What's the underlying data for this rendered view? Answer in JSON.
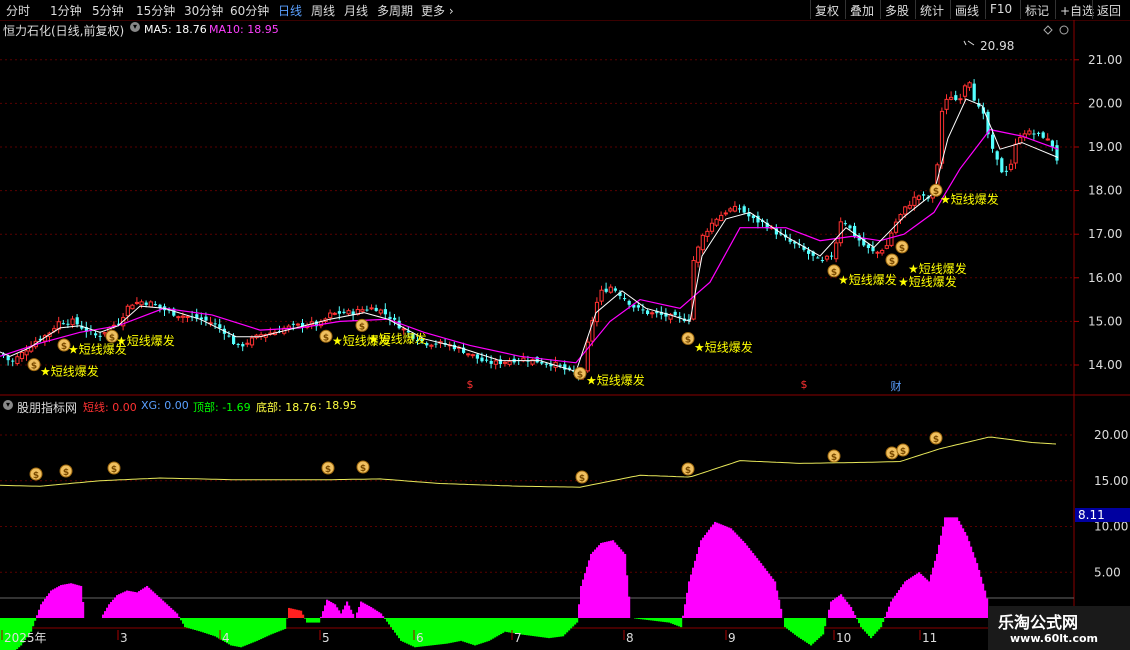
{
  "toolbar": {
    "periods": [
      "分时",
      "1分钟",
      "5分钟",
      "15分钟",
      "30分钟",
      "60分钟",
      "日线",
      "周线",
      "月线",
      "多周期",
      "更多"
    ],
    "selected": "日线",
    "right_buttons": [
      "复权",
      "叠加",
      "多股",
      "统计",
      "画线",
      "F10",
      "标记",
      "+自选",
      "返回"
    ]
  },
  "main_header": {
    "stock_label": "恒力石化(日线,前复权)",
    "ma5": "MA5: 18.76",
    "ma10": "MA10: 18.95"
  },
  "indicator_header": {
    "name": "股朋指标网",
    "duanxian": "短线: 0.00",
    "xg": "XG: 0.00",
    "dingbu": "顶部: -1.69",
    "dibu": "底部: 18.76",
    "dibu2": ": 18.95"
  },
  "price_axis_labels": [
    "21.00",
    "20.00",
    "19.00",
    "18.00",
    "17.00",
    "16.00",
    "15.00",
    "14.00"
  ],
  "indicator_axis_labels": [
    "20.00",
    "15.00",
    "10.00",
    "5.00"
  ],
  "indicator_current_value": "8.11",
  "max_price_label": "20.98",
  "signal_label": "★短线爆发",
  "event_markers": {
    "s": "$",
    "cai": "财"
  },
  "date_labels": [
    "2025年",
    "3",
    "4",
    "5",
    "6",
    "7",
    "8",
    "9",
    "10",
    "11"
  ],
  "brand": {
    "name": "乐淘公式网",
    "url": "www.60lt.com"
  },
  "colors": {
    "up": "#ff3232",
    "down": "#54ffff",
    "ma5": "#ffffff",
    "ma10": "#ff00ff",
    "signal": "#ffff00",
    "magenta_bar": "#ff00ff",
    "green_bar": "#00ff00"
  },
  "chart_data": {
    "type": "candlestick",
    "ylim": [
      13.5,
      21.3
    ],
    "keypoints": [
      [
        0,
        14.25
      ],
      [
        10,
        14.05
      ],
      [
        22,
        14.3
      ],
      [
        34,
        14.55
      ],
      [
        46,
        14.7
      ],
      [
        58,
        15.0
      ],
      [
        72,
        15.0
      ],
      [
        84,
        14.8
      ],
      [
        96,
        14.65
      ],
      [
        108,
        14.85
      ],
      [
        118,
        15.0
      ],
      [
        128,
        15.4
      ],
      [
        140,
        15.45
      ],
      [
        152,
        15.4
      ],
      [
        164,
        15.25
      ],
      [
        176,
        15.15
      ],
      [
        188,
        15.1
      ],
      [
        200,
        15.05
      ],
      [
        212,
        14.95
      ],
      [
        224,
        14.75
      ],
      [
        236,
        14.4
      ],
      [
        248,
        14.55
      ],
      [
        260,
        14.7
      ],
      [
        272,
        14.75
      ],
      [
        284,
        14.85
      ],
      [
        296,
        14.9
      ],
      [
        308,
        14.95
      ],
      [
        318,
        14.9
      ],
      [
        328,
        15.15
      ],
      [
        340,
        15.2
      ],
      [
        352,
        15.2
      ],
      [
        364,
        15.3
      ],
      [
        376,
        15.3
      ],
      [
        388,
        15.1
      ],
      [
        400,
        14.85
      ],
      [
        412,
        14.65
      ],
      [
        424,
        14.5
      ],
      [
        436,
        14.5
      ],
      [
        448,
        14.45
      ],
      [
        460,
        14.35
      ],
      [
        472,
        14.2
      ],
      [
        484,
        14.05
      ],
      [
        496,
        14.05
      ],
      [
        508,
        14.1
      ],
      [
        520,
        14.15
      ],
      [
        532,
        14.1
      ],
      [
        544,
        14.05
      ],
      [
        556,
        14.0
      ],
      [
        566,
        13.85
      ],
      [
        576,
        13.8
      ],
      [
        582,
        13.75
      ],
      [
        588,
        14.8
      ],
      [
        598,
        15.65
      ],
      [
        610,
        15.8
      ],
      [
        622,
        15.55
      ],
      [
        634,
        15.3
      ],
      [
        646,
        15.2
      ],
      [
        658,
        15.15
      ],
      [
        670,
        15.1
      ],
      [
        682,
        15.05
      ],
      [
        688,
        15.1
      ],
      [
        692,
        16.4
      ],
      [
        702,
        17.0
      ],
      [
        714,
        17.35
      ],
      [
        726,
        17.55
      ],
      [
        738,
        17.6
      ],
      [
        750,
        17.35
      ],
      [
        762,
        17.25
      ],
      [
        774,
        17.05
      ],
      [
        786,
        16.85
      ],
      [
        798,
        16.7
      ],
      [
        810,
        16.5
      ],
      [
        820,
        16.35
      ],
      [
        832,
        16.55
      ],
      [
        840,
        17.4
      ],
      [
        852,
        17.0
      ],
      [
        864,
        16.7
      ],
      [
        874,
        16.55
      ],
      [
        886,
        16.75
      ],
      [
        892,
        17.2
      ],
      [
        904,
        17.6
      ],
      [
        916,
        17.9
      ],
      [
        926,
        17.8
      ],
      [
        934,
        18.1
      ],
      [
        940,
        19.8
      ],
      [
        948,
        20.2
      ],
      [
        956,
        20.05
      ],
      [
        962,
        20.3
      ],
      [
        966,
        20.7
      ],
      [
        974,
        20.0
      ],
      [
        982,
        19.7
      ],
      [
        990,
        18.95
      ],
      [
        1000,
        18.45
      ],
      [
        1008,
        18.5
      ],
      [
        1016,
        19.2
      ],
      [
        1022,
        19.35
      ],
      [
        1032,
        19.3
      ],
      [
        1042,
        19.25
      ],
      [
        1052,
        19.0
      ],
      [
        1058,
        18.5
      ]
    ],
    "ma5_path": [
      [
        0,
        14.3
      ],
      [
        10,
        14.2
      ],
      [
        30,
        14.4
      ],
      [
        46,
        14.65
      ],
      [
        60,
        14.85
      ],
      [
        80,
        14.9
      ],
      [
        100,
        14.75
      ],
      [
        118,
        14.9
      ],
      [
        140,
        15.35
      ],
      [
        164,
        15.3
      ],
      [
        200,
        15.05
      ],
      [
        236,
        14.65
      ],
      [
        260,
        14.65
      ],
      [
        296,
        14.85
      ],
      [
        330,
        15.05
      ],
      [
        364,
        15.2
      ],
      [
        388,
        15.05
      ],
      [
        424,
        14.6
      ],
      [
        460,
        14.4
      ],
      [
        500,
        14.1
      ],
      [
        540,
        14.1
      ],
      [
        576,
        13.85
      ],
      [
        596,
        15.2
      ],
      [
        622,
        15.7
      ],
      [
        646,
        15.3
      ],
      [
        670,
        15.15
      ],
      [
        690,
        15.0
      ],
      [
        702,
        16.5
      ],
      [
        726,
        17.35
      ],
      [
        750,
        17.5
      ],
      [
        786,
        16.95
      ],
      [
        820,
        16.5
      ],
      [
        846,
        17.15
      ],
      [
        874,
        16.7
      ],
      [
        904,
        17.4
      ],
      [
        934,
        17.95
      ],
      [
        948,
        19.2
      ],
      [
        966,
        20.1
      ],
      [
        982,
        19.95
      ],
      [
        1000,
        18.95
      ],
      [
        1022,
        19.1
      ],
      [
        1058,
        18.76
      ]
    ],
    "ma10_path": [
      [
        0,
        14.2
      ],
      [
        40,
        14.5
      ],
      [
        80,
        14.75
      ],
      [
        118,
        14.9
      ],
      [
        164,
        15.3
      ],
      [
        212,
        15.15
      ],
      [
        260,
        14.8
      ],
      [
        300,
        14.85
      ],
      [
        340,
        15.0
      ],
      [
        388,
        15.05
      ],
      [
        424,
        14.75
      ],
      [
        470,
        14.45
      ],
      [
        520,
        14.2
      ],
      [
        576,
        14.05
      ],
      [
        610,
        15.0
      ],
      [
        640,
        15.5
      ],
      [
        680,
        15.3
      ],
      [
        710,
        15.9
      ],
      [
        740,
        17.15
      ],
      [
        786,
        17.15
      ],
      [
        820,
        16.85
      ],
      [
        852,
        16.95
      ],
      [
        880,
        16.85
      ],
      [
        904,
        17.0
      ],
      [
        934,
        17.5
      ],
      [
        960,
        18.5
      ],
      [
        990,
        19.4
      ],
      [
        1022,
        19.25
      ],
      [
        1058,
        18.95
      ]
    ],
    "signals": [
      [
        34,
        14.1
      ],
      [
        64,
        14.55
      ],
      [
        112,
        14.75
      ],
      [
        326,
        14.75
      ],
      [
        362,
        15.0
      ],
      [
        580,
        13.9
      ],
      [
        688,
        14.7
      ],
      [
        834,
        16.25
      ],
      [
        892,
        16.5
      ],
      [
        902,
        16.8
      ],
      [
        936,
        18.1
      ]
    ],
    "signal_labels": [
      [
        40,
        13.85
      ],
      [
        68,
        14.35
      ],
      [
        116,
        14.55
      ],
      [
        332,
        14.55
      ],
      [
        368,
        14.6
      ],
      [
        586,
        13.65
      ],
      [
        694,
        14.4
      ],
      [
        838,
        15.95
      ],
      [
        898,
        15.9
      ],
      [
        908,
        16.2
      ],
      [
        940,
        17.8
      ]
    ],
    "hist": [
      [
        0,
        -4
      ],
      [
        10,
        -4
      ],
      [
        20,
        -3
      ],
      [
        30,
        -1.5
      ],
      [
        40,
        1.5
      ],
      [
        50,
        3
      ],
      [
        60,
        3.6
      ],
      [
        70,
        3.8
      ],
      [
        80,
        3.5
      ],
      [
        84,
        0
      ],
      [
        100,
        0
      ],
      [
        108,
        1.5
      ],
      [
        116,
        2.5
      ],
      [
        126,
        3.0
      ],
      [
        136,
        2.8
      ],
      [
        146,
        3.5
      ],
      [
        156,
        2.5
      ],
      [
        166,
        1.5
      ],
      [
        176,
        0.5
      ],
      [
        184,
        -1
      ],
      [
        200,
        -1.5
      ],
      [
        214,
        -2
      ],
      [
        230,
        -3
      ],
      [
        240,
        -3.2
      ],
      [
        256,
        -2.5
      ],
      [
        270,
        -1.8
      ],
      [
        284,
        -1.2
      ],
      [
        288,
        1.1
      ],
      [
        300,
        0.8
      ],
      [
        306,
        -0.5
      ],
      [
        318,
        -0.5
      ],
      [
        326,
        2.0
      ],
      [
        334,
        1.5
      ],
      [
        340,
        0.5
      ],
      [
        346,
        1.8
      ],
      [
        354,
        0
      ],
      [
        360,
        1.8
      ],
      [
        370,
        1.2
      ],
      [
        380,
        0.5
      ],
      [
        390,
        -1
      ],
      [
        400,
        -2.5
      ],
      [
        414,
        -3.2
      ],
      [
        430,
        -3
      ],
      [
        446,
        -2.8
      ],
      [
        460,
        -2.5
      ],
      [
        474,
        -3.0
      ],
      [
        488,
        -2.5
      ],
      [
        504,
        -1.5
      ],
      [
        520,
        -1.8
      ],
      [
        534,
        -2
      ],
      [
        548,
        -2.2
      ],
      [
        562,
        -2
      ],
      [
        576,
        -0.5
      ],
      [
        580,
        3.5
      ],
      [
        590,
        7
      ],
      [
        600,
        8.2
      ],
      [
        612,
        8.5
      ],
      [
        624,
        7
      ],
      [
        630,
        0
      ],
      [
        668,
        -0.5
      ],
      [
        680,
        -1
      ],
      [
        688,
        4
      ],
      [
        700,
        8.5
      ],
      [
        714,
        10.5
      ],
      [
        730,
        9.8
      ],
      [
        744,
        8.2
      ],
      [
        760,
        6
      ],
      [
        774,
        4
      ],
      [
        784,
        -1
      ],
      [
        796,
        -2
      ],
      [
        810,
        -3
      ],
      [
        822,
        -1.8
      ],
      [
        830,
        1.8
      ],
      [
        840,
        2.6
      ],
      [
        850,
        1.2
      ],
      [
        860,
        -1
      ],
      [
        870,
        -2.2
      ],
      [
        880,
        -1
      ],
      [
        890,
        1.8
      ],
      [
        904,
        4
      ],
      [
        918,
        5
      ],
      [
        928,
        4
      ],
      [
        936,
        7
      ],
      [
        944,
        11
      ],
      [
        956,
        11
      ],
      [
        966,
        9
      ],
      [
        976,
        6
      ],
      [
        984,
        3
      ],
      [
        992,
        -0.5
      ],
      [
        1012,
        -0.5
      ],
      [
        1020,
        1.2
      ],
      [
        1030,
        1.3
      ],
      [
        1040,
        0.5
      ],
      [
        1050,
        0.3
      ],
      [
        1058,
        0
      ]
    ],
    "indicator_line": [
      [
        0,
        14.5
      ],
      [
        40,
        14.4
      ],
      [
        100,
        15.0
      ],
      [
        160,
        15.3
      ],
      [
        240,
        15.1
      ],
      [
        320,
        15.1
      ],
      [
        380,
        15.2
      ],
      [
        440,
        14.7
      ],
      [
        520,
        14.4
      ],
      [
        580,
        14.3
      ],
      [
        640,
        15.6
      ],
      [
        690,
        15.4
      ],
      [
        740,
        17.2
      ],
      [
        800,
        16.9
      ],
      [
        860,
        17.0
      ],
      [
        900,
        17.1
      ],
      [
        940,
        18.5
      ],
      [
        990,
        19.8
      ],
      [
        1030,
        19.2
      ],
      [
        1058,
        19.0
      ]
    ]
  }
}
